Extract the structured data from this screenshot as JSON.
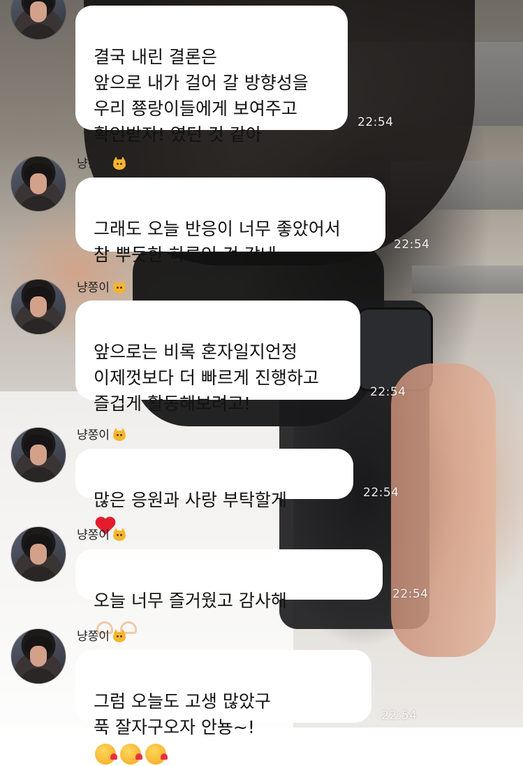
{
  "chat": {
    "sender_name": "냥쫑이",
    "messages": [
      {
        "text": "결국 내린 결론은\n앞으로 내가 걸어 갈 방향성을\n우리 쭁랑이들에게 보여주고\n확인받자! 였던 것 같아",
        "time": "22:54",
        "show_sender": false
      },
      {
        "text": "그래도 오늘 반응이 너무 좋았어서\n참 뿌듯한 하루인 것 같네",
        "time": "22:54",
        "show_sender": true
      },
      {
        "text": "앞으로는 비록 혼자일지언정\n이제껏보다 더 빠르게 진행하고\n즐겁게 활동해보려고!",
        "time": "22:54",
        "show_sender": true
      },
      {
        "text": "많은 응원과 사랑 부탁할게",
        "emoji": [
          "heart"
        ],
        "time": "22:54",
        "show_sender": true
      },
      {
        "text": "오늘 너무 즐거웠고 감사해",
        "emoji": [
          "heart-hands",
          "heart-hands"
        ],
        "time": "22:54",
        "show_sender": true
      },
      {
        "text": "그럼 오늘도 고생 많았구\n푹 잘자구오자 안뇽~!",
        "emoji": [
          "kissing-face",
          "kissing-face",
          "kissing-face"
        ],
        "time": "22:54",
        "show_sender": true
      }
    ]
  },
  "icons": {
    "sender_badge": "cat-face-icon"
  }
}
